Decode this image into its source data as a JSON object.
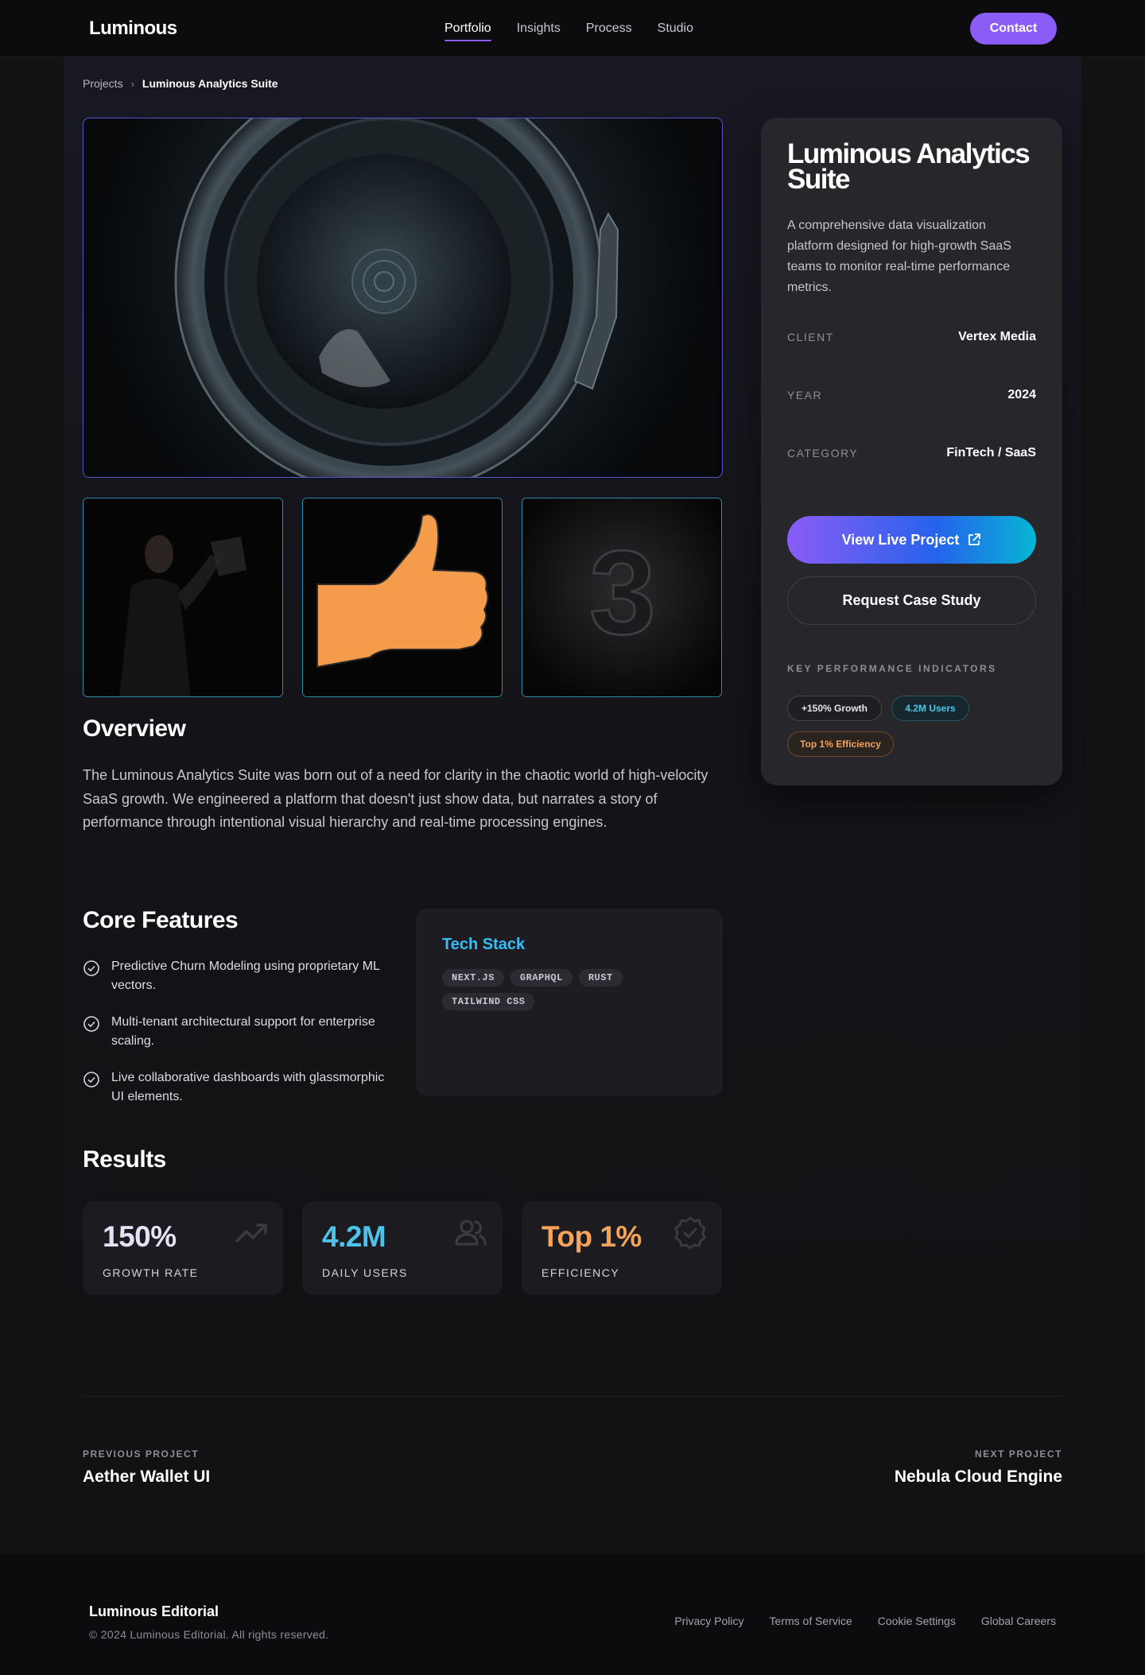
{
  "nav": {
    "brand": "Luminous",
    "links": [
      "Portfolio",
      "Insights",
      "Process",
      "Studio"
    ],
    "active": "Portfolio",
    "contact": "Contact"
  },
  "breadcrumb": {
    "parent": "Projects",
    "separator": "›",
    "current": "Luminous Analytics Suite"
  },
  "gallery": {
    "hero_icon": "speaker-porthole-image",
    "thumbs": [
      "man-holding-object-image",
      "thumbs-up-image",
      "number-3-image"
    ],
    "thumb_3_glyph": "3"
  },
  "overview": {
    "heading": "Overview",
    "text": "The Luminous Analytics Suite was born out of a need for clarity in the chaotic world of high-velocity SaaS growth. We engineered a platform that doesn't just show data, but narrates a story of performance through intentional visual hierarchy and real-time processing engines."
  },
  "features": {
    "heading": "Core Features",
    "items": [
      "Predictive Churn Modeling using proprietary ML vectors.",
      "Multi-tenant architectural support for enterprise scaling.",
      "Live collaborative dashboards with glassmorphic UI elements."
    ]
  },
  "tech": {
    "title": "Tech Stack",
    "chips": [
      "NEXT.JS",
      "GRAPHQL",
      "RUST",
      "TAILWIND CSS"
    ]
  },
  "results": {
    "heading": "Results",
    "stats": [
      {
        "value": "150%",
        "label": "GROWTH RATE",
        "color": "#e4e2f5",
        "icon": "trending-up-icon"
      },
      {
        "value": "4.2M",
        "label": "DAILY USERS",
        "color": "#4cc3ea",
        "icon": "users-icon"
      },
      {
        "value": "Top 1%",
        "label": "EFFICIENCY",
        "color": "#f5a25a",
        "icon": "verified-badge-icon"
      }
    ]
  },
  "sidebar": {
    "title": "Luminous Analytics Suite",
    "description": "A comprehensive data visualization platform designed for high-growth SaaS teams to monitor real-time performance metrics.",
    "meta": [
      {
        "key": "CLIENT",
        "value": "Vertex Media"
      },
      {
        "key": "YEAR",
        "value": "2024"
      },
      {
        "key": "CATEGORY",
        "value": "FinTech / SaaS"
      }
    ],
    "live_button": "View Live Project",
    "case_button": "Request Case Study",
    "kpi_title": "KEY PERFORMANCE INDICATORS",
    "kpis": [
      {
        "label": "+150% Growth",
        "color": "#e6e6ea"
      },
      {
        "label": "4.2M Users",
        "color": "#4cc3ea"
      },
      {
        "label": "Top 1% Efficiency",
        "color": "#f5a25a"
      }
    ]
  },
  "pagination": {
    "prev_label": "PREVIOUS PROJECT",
    "prev_name": "Aether Wallet UI",
    "next_label": "NEXT PROJECT",
    "next_name": "Nebula Cloud Engine"
  },
  "footer": {
    "brand": "Luminous Editorial",
    "copyright": "© 2024 Luminous Editorial. All rights reserved.",
    "links": [
      "Privacy Policy",
      "Terms of Service",
      "Cookie Settings",
      "Global Careers"
    ]
  },
  "colors": {
    "accent": "#8b5cf6",
    "cyan": "#06b6d4",
    "orange": "#f59f5a",
    "bg": "#121214"
  }
}
